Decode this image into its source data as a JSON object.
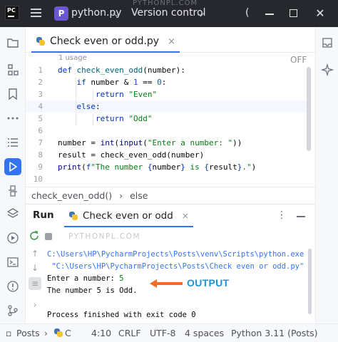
{
  "titlebar": {
    "logo_text": "PC",
    "project_badge": "P",
    "project_name": "python.py",
    "vcs_label": "Version control",
    "watermark": "PYTHONPL.COM",
    "partial_text": "("
  },
  "tab": {
    "label": "Check even or odd.py",
    "close": "×"
  },
  "editor": {
    "usage_hint": "1 usage",
    "inspection_state": "OFF",
    "current_line": 4,
    "lines": [
      {
        "n": "1",
        "code": "def check_even_odd(number):"
      },
      {
        "n": "2",
        "code": "    if number & 1 == 0:"
      },
      {
        "n": "3",
        "code": "        return \"Even\""
      },
      {
        "n": "4",
        "code": "    else:"
      },
      {
        "n": "5",
        "code": "        return \"Odd\""
      },
      {
        "n": "6",
        "code": ""
      },
      {
        "n": "7",
        "code": "number = int(input(\"Enter a number: \"))"
      },
      {
        "n": "8",
        "code": "result = check_even_odd(number)"
      },
      {
        "n": "9",
        "code": "print(f\"The number {number} is {result}.\")"
      },
      {
        "n": "10",
        "code": ""
      }
    ],
    "breadcrumbs": [
      "check_even_odd()",
      "else"
    ]
  },
  "run": {
    "title": "Run",
    "tab_label": "Check even or odd",
    "tab_close": "×",
    "more": "⋮",
    "watermark": "PYTHONPL.COM",
    "console": {
      "line1": "C:\\Users\\HP\\PycharmProjects\\Posts\\venv\\Scripts\\python.exe",
      "line2": " \"C:\\Users\\HP\\PycharmProjects\\Posts\\Check even or odd.py\"",
      "prompt": "Enter a number: ",
      "user_input": "5",
      "result": "The number 5 is Odd.",
      "exit": "Process finished with exit code 0"
    },
    "annotation": "OUTPUT"
  },
  "statusbar": {
    "project": "Posts",
    "separator": "›",
    "file_partial": "C",
    "position": "4:10",
    "line_ending": "CRLF",
    "encoding": "UTF-8",
    "indent": "4 spaces",
    "interpreter": "Python 3.11 (Posts)"
  },
  "colors": {
    "accent": "#3574f0",
    "titlebar_bg": "#27282e",
    "annotation": "#1d92d6",
    "annotation_arrow": "#f26b21",
    "keyword": "#0033b3",
    "string": "#067d17"
  },
  "icons": {
    "left_toolbar": [
      "folder-icon",
      "structure-icon",
      "bookmark-icon",
      "more-icon",
      "todo-list-icon",
      "run-icon",
      "python-console-icon",
      "layers-icon",
      "services-icon",
      "terminal-icon",
      "problems-icon",
      "git-icon"
    ],
    "right_toolbar": [
      "notifications-icon",
      "ai-assistant-icon"
    ]
  }
}
